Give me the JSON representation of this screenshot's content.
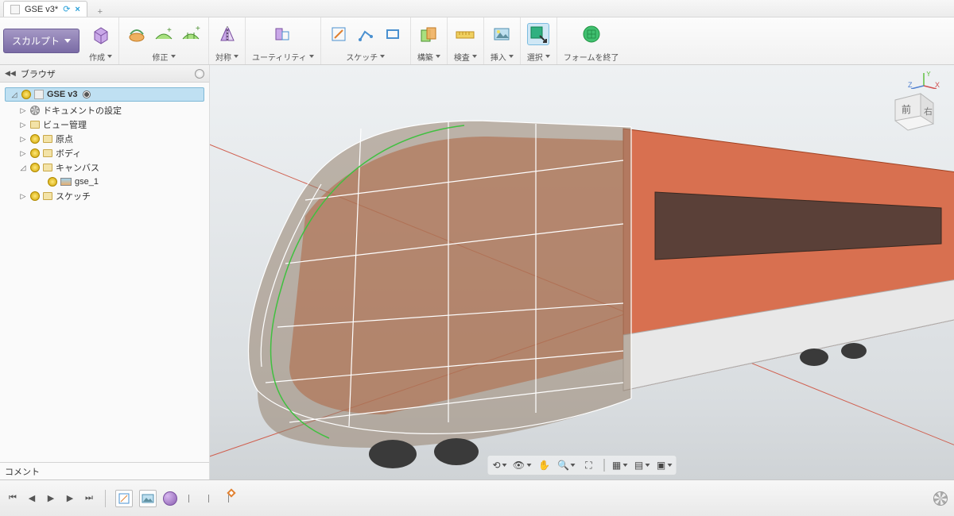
{
  "tab": {
    "title": "GSE v3*",
    "add": "+"
  },
  "mode_button": "スカルプト",
  "ribbon_groups": [
    {
      "id": "create",
      "label": "作成",
      "dd": true
    },
    {
      "id": "modify",
      "label": "修正",
      "dd": true
    },
    {
      "id": "symmetry",
      "label": "対称",
      "dd": true
    },
    {
      "id": "utilities",
      "label": "ユーティリティ",
      "dd": true
    },
    {
      "id": "sketch",
      "label": "スケッチ",
      "dd": true
    },
    {
      "id": "construct",
      "label": "構築",
      "dd": true
    },
    {
      "id": "inspect",
      "label": "検査",
      "dd": true
    },
    {
      "id": "insert",
      "label": "挿入",
      "dd": true
    },
    {
      "id": "select",
      "label": "選択",
      "dd": true
    },
    {
      "id": "finish",
      "label": "フォームを終了",
      "dd": false
    }
  ],
  "browser": {
    "title": "ブラウザ",
    "root": "GSE v3",
    "items": [
      {
        "icon": "gear",
        "label": "ドキュメントの設定"
      },
      {
        "icon": "folder",
        "label": "ビュー管理"
      },
      {
        "icon": "folder",
        "label": "原点",
        "bulb": true
      },
      {
        "icon": "folder",
        "label": "ボディ",
        "bulb": true
      },
      {
        "icon": "folder",
        "label": "キャンバス",
        "bulb": true,
        "open": true
      },
      {
        "icon": "pic",
        "label": "gse_1",
        "bulb": true,
        "child": true
      },
      {
        "icon": "folder",
        "label": "スケッチ",
        "bulb": true
      }
    ],
    "comment": "コメント"
  },
  "viewcube": {
    "front": "前",
    "right": "右",
    "axes": {
      "x": "X",
      "y": "Y",
      "z": "Z"
    }
  },
  "navbar_icons": [
    "orbit-icon",
    "look-icon",
    "pan-icon",
    "zoom-icon",
    "fit-icon",
    "display-icon",
    "grid-icon",
    "snap-icon"
  ],
  "timeline_icons": [
    "go-start-icon",
    "step-back-icon",
    "play-icon",
    "step-fwd-icon",
    "go-end-icon"
  ]
}
